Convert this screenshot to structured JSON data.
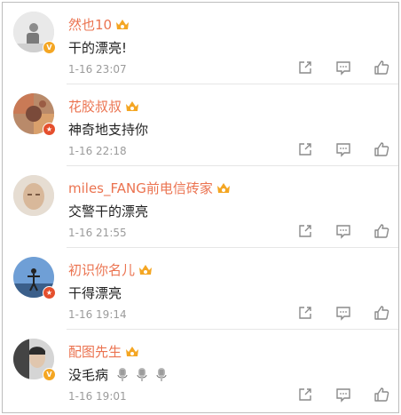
{
  "comments": [
    {
      "name": "然也10",
      "text": "干的漂亮!",
      "time": "1-16 23:07",
      "badge": "gold",
      "badge_glyph": "V",
      "emoji": []
    },
    {
      "name": "花胶叔叔",
      "text": "神奇地支持你",
      "time": "1-16 22:18",
      "badge": "red",
      "badge_glyph": "★",
      "emoji": []
    },
    {
      "name": "miles_FANG前电信砖家",
      "text": "交警干的漂亮",
      "time": "1-16 21:55",
      "badge": "none",
      "badge_glyph": "",
      "emoji": []
    },
    {
      "name": "初识你名儿",
      "text": "干得漂亮",
      "time": "1-16 19:14",
      "badge": "red",
      "badge_glyph": "★",
      "emoji": []
    },
    {
      "name": "配图先生",
      "text": "没毛病",
      "time": "1-16 19:01",
      "badge": "gold",
      "badge_glyph": "V",
      "emoji": [
        "microphone-emoji",
        "microphone-emoji",
        "microphone-emoji"
      ]
    }
  ],
  "icons": {
    "vip": "vip-crown-icon",
    "share": "share-icon",
    "reply": "comment-icon",
    "like": "thumbs-up-icon"
  },
  "colors": {
    "name": "#eb7350",
    "text": "#222222",
    "time": "#9b9b9b",
    "icon": "#8a8a8a",
    "vip": "#f4a623",
    "badge_gold": "#f4a623",
    "badge_red": "#e54f2d"
  }
}
